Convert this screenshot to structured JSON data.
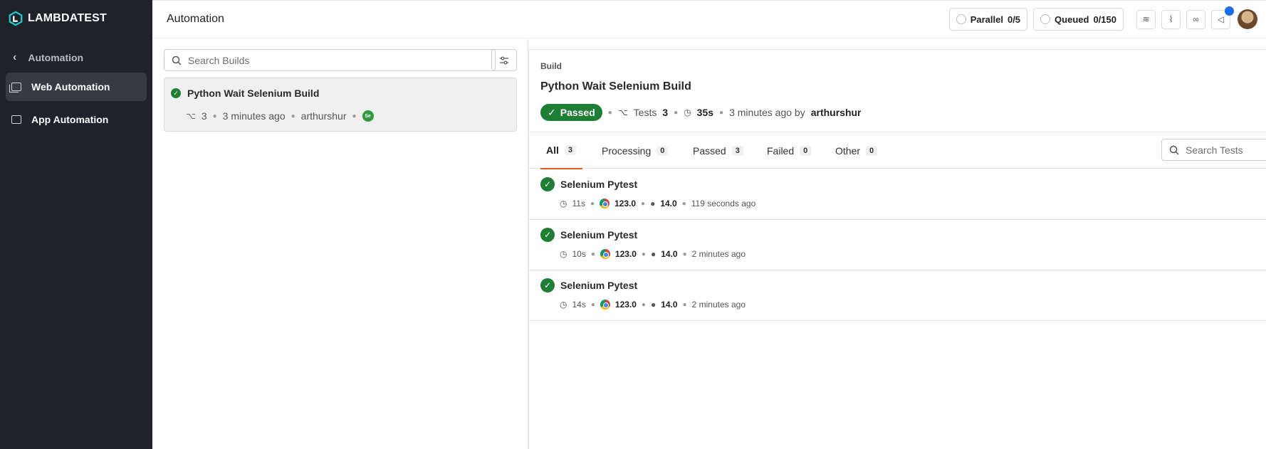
{
  "brand": {
    "name": "LAMBDATEST"
  },
  "sidebar": {
    "back_label": "Automation",
    "items": [
      {
        "label": "Web Automation",
        "active": true
      },
      {
        "label": "App Automation",
        "active": false
      }
    ]
  },
  "header": {
    "title": "Automation",
    "parallel": {
      "label": "Parallel",
      "value": "0/5"
    },
    "queued": {
      "label": "Queued",
      "value": "0/150"
    }
  },
  "builds": {
    "search_placeholder": "Search Builds",
    "list": [
      {
        "name": "Python Wait Selenium Build",
        "tests": "3",
        "time": "3 minutes ago",
        "user": "arthurshur",
        "status": "passed"
      }
    ]
  },
  "detail": {
    "label": "Build",
    "title": "Python Wait Selenium Build",
    "status": "Passed",
    "tests_label": "Tests",
    "tests_count": "3",
    "duration": "35s",
    "time": "3 minutes ago by",
    "user": "arthurshur",
    "tabs": [
      {
        "label": "All",
        "count": "3",
        "active": true
      },
      {
        "label": "Processing",
        "count": "0",
        "active": false
      },
      {
        "label": "Passed",
        "count": "3",
        "active": false
      },
      {
        "label": "Failed",
        "count": "0",
        "active": false
      },
      {
        "label": "Other",
        "count": "0",
        "active": false
      }
    ],
    "search_tests_placeholder": "Search Tests",
    "tests": [
      {
        "name": "Selenium Pytest",
        "duration": "11s",
        "browser_version": "123.0",
        "os_version": "14.0",
        "time": "119 seconds ago"
      },
      {
        "name": "Selenium Pytest",
        "duration": "10s",
        "browser_version": "123.0",
        "os_version": "14.0",
        "time": "2 minutes ago"
      },
      {
        "name": "Selenium Pytest",
        "duration": "14s",
        "browser_version": "123.0",
        "os_version": "14.0",
        "time": "2 minutes ago"
      }
    ]
  },
  "colors": {
    "sidebar_bg": "#1f2329",
    "passed": "#1e7e34",
    "tab_accent": "#e8572a",
    "notification": "#1b6ce8"
  }
}
